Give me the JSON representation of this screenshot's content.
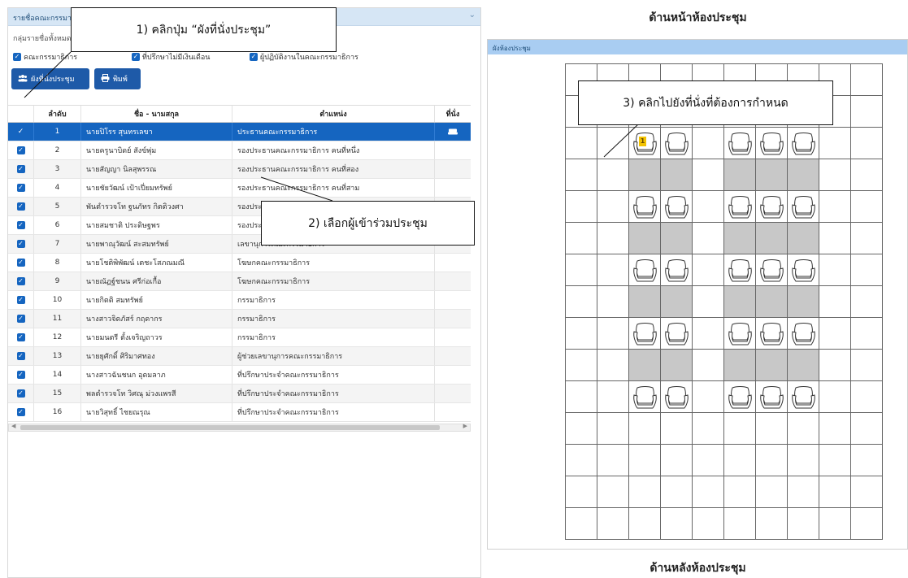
{
  "left_panel": {
    "title": "รายชื่อคณะกรรมาธิ",
    "group_label": "กลุ่มรายชื่อทั้งหมดข",
    "filters": [
      {
        "label": "คณะกรรมาธิการ",
        "checked": true
      },
      {
        "label": "ที่ปรึกษาไม่มีเงินเดือน",
        "checked": true
      },
      {
        "label": "ผู้ปฏิบัติงานในคณะกรรมาธิการ",
        "checked": true
      }
    ],
    "buttons": {
      "seat_chart": "ผังที่นั่งประชุม",
      "print": "พิมพ์"
    }
  },
  "table": {
    "headers": {
      "no": "ลำดับ",
      "name": "ชื่อ - นามสกุล",
      "position": "ตำแหน่ง",
      "seat": "ที่นั่ง"
    },
    "rows": [
      {
        "no": "1",
        "name": "นายปิโรร สุนทรเลขา",
        "position": "ประธานคณะกรรมาธิการ",
        "selected": true,
        "has_seat_icon": true
      },
      {
        "no": "2",
        "name": "นายครูนาบิดย์ สังข์พุ่ม",
        "position": "รองประธานคณะกรรมาธิการ คนที่หนึ่ง"
      },
      {
        "no": "3",
        "name": "นายสัญญา นิลสุพรรณ",
        "position": "รองประธานคณะกรรมาธิการ คนที่สอง"
      },
      {
        "no": "4",
        "name": "นายชัยวัฒน์ เป้าเปี่ยมทรัพย์",
        "position": "รองประธานคณะกรรมาธิการ คนที่สาม"
      },
      {
        "no": "5",
        "name": "พันตำรวจโท ฐนภัทร กิตติวงศา",
        "position": "รองประ"
      },
      {
        "no": "6",
        "name": "นายสมชาติ ประดิษฐพร",
        "position": "รองประ"
      },
      {
        "no": "7",
        "name": "นายพาณุวัฒน์ สะสมทรัพย์",
        "position": "เลขานุการคณะกรรมาธิการ"
      },
      {
        "no": "8",
        "name": "นายโชติพิพัฒน์ เตชะโสภณมณี",
        "position": "โฆษกคณะกรรมาธิการ"
      },
      {
        "no": "9",
        "name": "นายณัฏฐ์ชนน ศรีก่อเกื้อ",
        "position": "โฆษกคณะกรรมาธิการ"
      },
      {
        "no": "10",
        "name": "นายกิตติ สมทรัพย์",
        "position": "กรรมาธิการ"
      },
      {
        "no": "11",
        "name": "นางสาวจิดภัสร์ กฤดากร",
        "position": "กรรมาธิการ"
      },
      {
        "no": "12",
        "name": "นายมนตรี ตั้งเจริญถาวร",
        "position": "กรรมาธิการ"
      },
      {
        "no": "13",
        "name": "นายยุศักดิ์ ศิริมาศทอง",
        "position": "ผู้ช่วยเลขานุการคณะกรรมาธิการ"
      },
      {
        "no": "14",
        "name": "นางสาวฉันชนก อุดมลาภ",
        "position": "ที่ปรึกษาประจำคณะกรรมาธิการ"
      },
      {
        "no": "15",
        "name": "พลตำรวจโท วิศณุ ม่วงแพรสี",
        "position": "ที่ปรึกษาประจำคณะกรรมาธิการ"
      },
      {
        "no": "16",
        "name": "นายวิสุทธิ์ ไชยณรุณ",
        "position": "ที่ปรึกษาประจำคณะกรรมาธิการ"
      }
    ]
  },
  "room": {
    "front_label": "ด้านหน้าห้องประชุม",
    "back_label": "ด้านหลังห้องประชุม",
    "panel_title": "ผังห้องประชุม",
    "assigned_seat_number": "1"
  },
  "callouts": {
    "step1": "1) คลิกปุ่ม “ผังที่นั่งประชุม”",
    "step2": "2) เลือกผู้เข้าร่วมประชุม",
    "step3": "3) คลิกไปยังที่นั่งที่ต้องการกำหนด"
  },
  "colors": {
    "primary": "#1565c0",
    "button": "#1e5aa8",
    "header_bg": "#d6e6f5",
    "room_header_bg": "#a9cdf2",
    "aisle_gray": "#c8c8c8",
    "seat_badge": "#f2c200"
  }
}
